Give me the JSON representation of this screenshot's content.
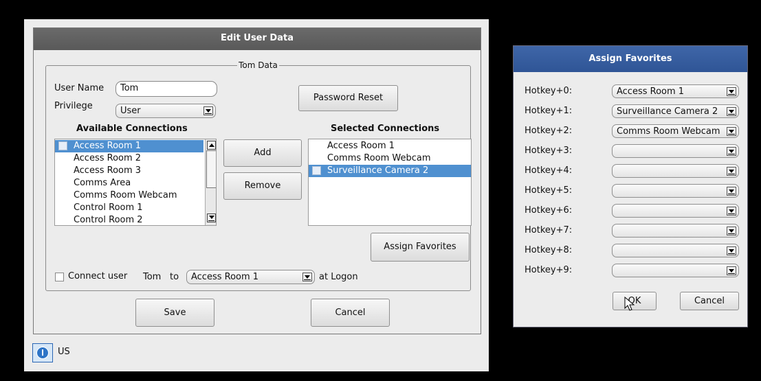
{
  "edit_dialog": {
    "title": "Edit User Data",
    "group_title": "Tom Data",
    "user_name_label": "User Name",
    "user_name_value": "Tom",
    "privilege_label": "Privilege",
    "privilege_value": "User",
    "password_reset": "Password Reset",
    "available_header": "Available Connections",
    "selected_header": "Selected Connections",
    "available": [
      {
        "label": "Access Room 1",
        "selected": true
      },
      {
        "label": "Access Room 2"
      },
      {
        "label": "Access Room 3"
      },
      {
        "label": "Comms Area"
      },
      {
        "label": "Comms Room Webcam"
      },
      {
        "label": "Control Room 1"
      },
      {
        "label": "Control Room 2"
      }
    ],
    "selected_list": [
      {
        "label": "Access Room 1"
      },
      {
        "label": "Comms Room Webcam"
      },
      {
        "label": "Surveillance Camera 2",
        "selected": true
      }
    ],
    "add": "Add",
    "remove": "Remove",
    "assign_favorites": "Assign Favorites",
    "connect_user_label": "Connect user",
    "connect_user_name": "Tom",
    "connect_to": "to",
    "connect_target": "Access Room 1",
    "at_logon": "at Logon",
    "save": "Save",
    "cancel": "Cancel"
  },
  "status_bar": {
    "locale": "US"
  },
  "favorites_dialog": {
    "title": "Assign Favorites",
    "hotkeys": [
      {
        "label": "Hotkey+0:",
        "value": "Access Room 1"
      },
      {
        "label": "Hotkey+1:",
        "value": "Surveillance Camera 2"
      },
      {
        "label": "Hotkey+2:",
        "value": "Comms Room Webcam"
      },
      {
        "label": "Hotkey+3:",
        "value": ""
      },
      {
        "label": "Hotkey+4:",
        "value": ""
      },
      {
        "label": "Hotkey+5:",
        "value": ""
      },
      {
        "label": "Hotkey+6:",
        "value": ""
      },
      {
        "label": "Hotkey+7:",
        "value": ""
      },
      {
        "label": "Hotkey+8:",
        "value": ""
      },
      {
        "label": "Hotkey+9:",
        "value": ""
      }
    ],
    "ok": "OK",
    "cancel": "Cancel"
  },
  "colors": {
    "selection": "#4f90d0",
    "title_gray": "#5f5f5f",
    "title_blue": "#3a60a2"
  }
}
